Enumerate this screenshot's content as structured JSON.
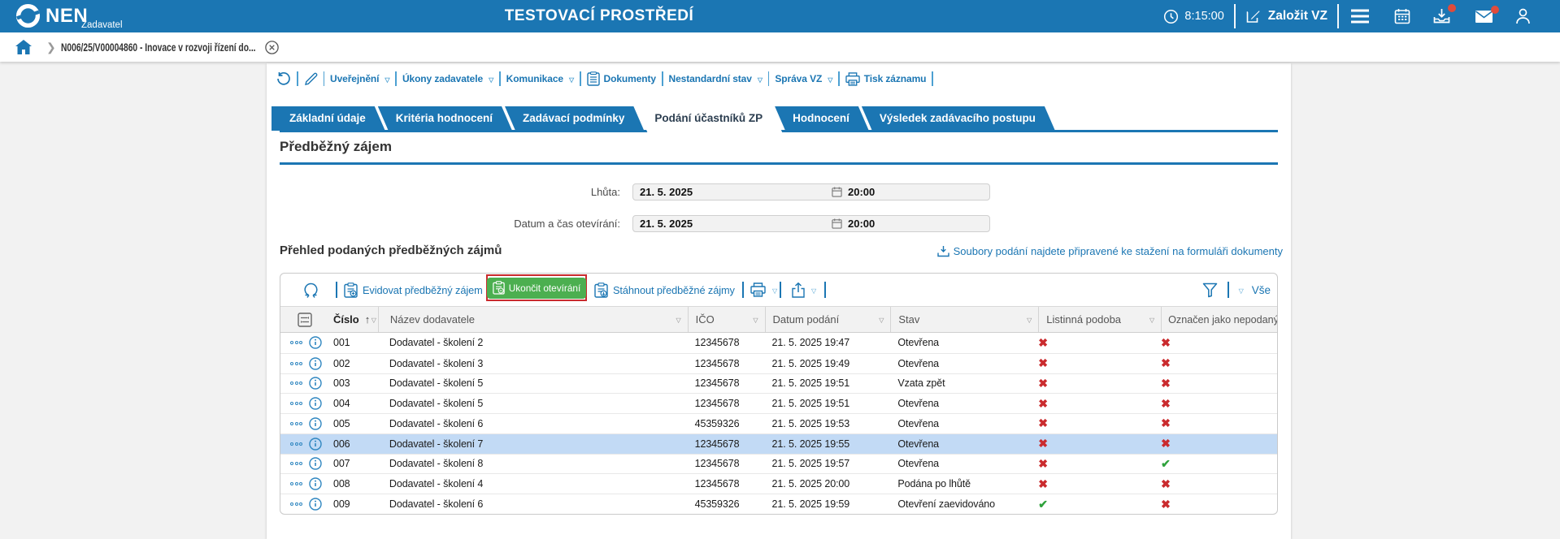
{
  "colors": {
    "brand": "#1b76b3",
    "page_bg": "#f2f2f2",
    "green_button": "#4caf50",
    "red_mark": "#ca2b2e",
    "green_mark": "#2fa23c",
    "row_highlight": "#c2daf5",
    "red_outline": "#ca2b2e"
  },
  "header": {
    "logo_text": "NEN",
    "logo_subtitle": "Zadavatel",
    "environment_title": "TESTOVACÍ PROSTŘEDÍ",
    "time": "8:15:00",
    "create_button": "Založit VZ"
  },
  "breadcrumb": {
    "item": "N006/25/V00004860 - Inovace v rozvoji řízení do...",
    "chevron": "›"
  },
  "action_toolbar": {
    "items": [
      {
        "label": "Uveřejnění",
        "caret": true
      },
      {
        "label": "Úkony zadavatele",
        "caret": true
      },
      {
        "label": "Komunikace",
        "caret": true
      },
      {
        "label": "Dokumenty",
        "icon": "document"
      },
      {
        "label": "Nestandardní stav",
        "caret": true
      },
      {
        "label": "Správa VZ",
        "caret": true
      },
      {
        "label": "Tisk záznamu",
        "icon": "printer"
      }
    ]
  },
  "tabs": [
    {
      "label": "Základní údaje"
    },
    {
      "label": "Kritéria hodnocení"
    },
    {
      "label": "Zadávací podmínky"
    },
    {
      "label": "Podání účastníků ZP",
      "active": true
    },
    {
      "label": "Hodnocení"
    },
    {
      "label": "Výsledek zadávacího postupu"
    }
  ],
  "section": {
    "title": "Předběžný zájem"
  },
  "fields": [
    {
      "label": "Lhůta:",
      "date": "21. 5. 2025",
      "time": "20:00"
    },
    {
      "label": "Datum a čas otevírání:",
      "date": "21. 5. 2025",
      "time": "20:00"
    }
  ],
  "list_section": {
    "title": "Přehled podaných předběžných zájmů",
    "download_link": "Soubory podání najdete připravené ke stažení na formuláři dokumenty"
  },
  "grid": {
    "toolbar": {
      "evidovat": "Evidovat předběžný zájem",
      "ukoncit": "Ukončit otevírání",
      "stahnout": "Stáhnout předběžné zájmy",
      "vse": "Vše"
    },
    "columns": [
      "Číslo",
      "Název dodavatele",
      "IČO",
      "Datum podání",
      "Stav",
      "Listinná podoba",
      "Označen jako nepodaný"
    ],
    "sort": {
      "column": "Číslo",
      "direction": "asc"
    },
    "rows": [
      {
        "cislo": "001",
        "nazev": "Dodavatel - školení 2",
        "ico": "12345678",
        "datum": "21. 5. 2025 19:47",
        "stav": "Otevřena",
        "listinna": false,
        "nepodany": false,
        "selected": false
      },
      {
        "cislo": "002",
        "nazev": "Dodavatel - školení 3",
        "ico": "12345678",
        "datum": "21. 5. 2025 19:49",
        "stav": "Otevřena",
        "listinna": false,
        "nepodany": false,
        "selected": false
      },
      {
        "cislo": "003",
        "nazev": "Dodavatel - školení 5",
        "ico": "12345678",
        "datum": "21. 5. 2025 19:51",
        "stav": "Vzata zpět",
        "listinna": false,
        "nepodany": false,
        "selected": false
      },
      {
        "cislo": "004",
        "nazev": "Dodavatel - školení 5",
        "ico": "12345678",
        "datum": "21. 5. 2025 19:51",
        "stav": "Otevřena",
        "listinna": false,
        "nepodany": false,
        "selected": false
      },
      {
        "cislo": "005",
        "nazev": "Dodavatel - školení 6",
        "ico": "45359326",
        "datum": "21. 5. 2025 19:53",
        "stav": "Otevřena",
        "listinna": false,
        "nepodany": false,
        "selected": false
      },
      {
        "cislo": "006",
        "nazev": "Dodavatel - školení 7",
        "ico": "12345678",
        "datum": "21. 5. 2025 19:55",
        "stav": "Otevřena",
        "listinna": false,
        "nepodany": false,
        "selected": true
      },
      {
        "cislo": "007",
        "nazev": "Dodavatel - školení 8",
        "ico": "12345678",
        "datum": "21. 5. 2025 19:57",
        "stav": "Otevřena",
        "listinna": false,
        "nepodany": true,
        "selected": false
      },
      {
        "cislo": "008",
        "nazev": "Dodavatel - školení 4",
        "ico": "12345678",
        "datum": "21. 5. 2025 20:00",
        "stav": "Podána po lhůtě",
        "listinna": false,
        "nepodany": false,
        "selected": false
      },
      {
        "cislo": "009",
        "nazev": "Dodavatel - školení 6",
        "ico": "45359326",
        "datum": "21. 5. 2025 19:59",
        "stav": "Otevření zaevidováno",
        "listinna": true,
        "nepodany": false,
        "selected": false
      }
    ]
  }
}
